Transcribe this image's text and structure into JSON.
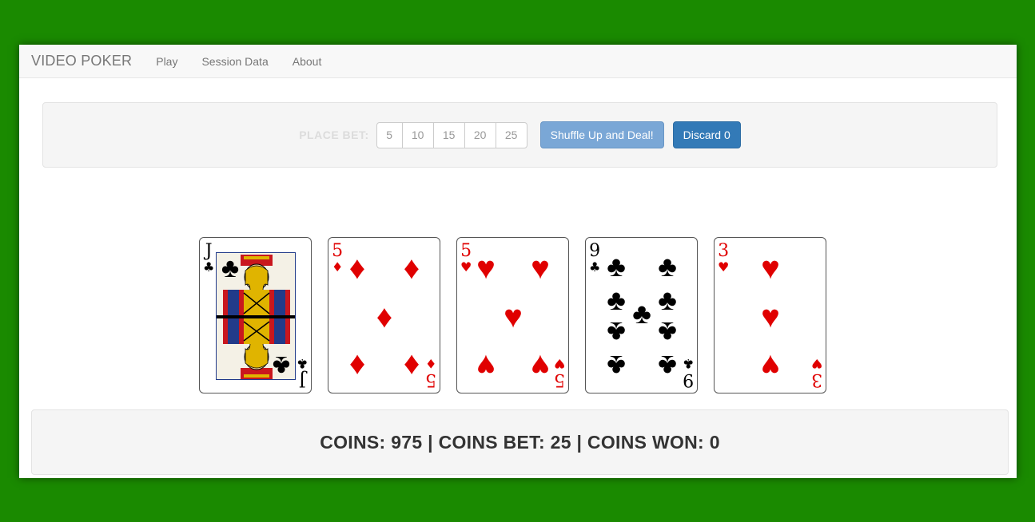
{
  "navbar": {
    "brand": "VIDEO POKER",
    "links": [
      "Play",
      "Session Data",
      "About"
    ]
  },
  "betting": {
    "label": "PLACE BET:",
    "options": [
      "5",
      "10",
      "15",
      "20",
      "25"
    ],
    "deal_label": "Shuffle Up and Deal!",
    "discard_label": "Discard 0"
  },
  "cards": [
    {
      "rank": "J",
      "suit": "♣",
      "suit_name": "clubs",
      "color": "black"
    },
    {
      "rank": "5",
      "suit": "♦",
      "suit_name": "diamonds",
      "color": "red"
    },
    {
      "rank": "5",
      "suit": "♥",
      "suit_name": "hearts",
      "color": "red"
    },
    {
      "rank": "9",
      "suit": "♣",
      "suit_name": "clubs",
      "color": "black"
    },
    {
      "rank": "3",
      "suit": "♥",
      "suit_name": "hearts",
      "color": "red"
    }
  ],
  "status": {
    "text": "COINS: 975 | COINS BET: 25 | COINS WON: 0"
  },
  "colors": {
    "background": "#1a8a00",
    "primary": "#337ab7",
    "primary_disabled": "#7aa7d6",
    "card_red": "#e00000"
  }
}
